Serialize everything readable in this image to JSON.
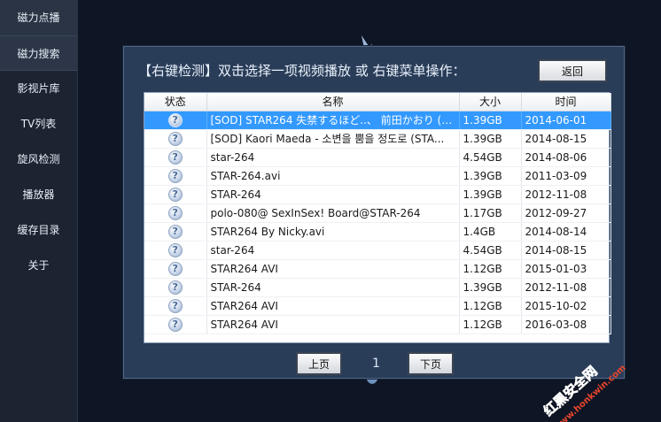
{
  "sidebar": {
    "items": [
      {
        "label": "磁力点播"
      },
      {
        "label": "磁力搜索"
      },
      {
        "label": "影视片库"
      },
      {
        "label": "TV列表"
      },
      {
        "label": "旋风检测"
      },
      {
        "label": "播放器"
      },
      {
        "label": "缓存目录"
      },
      {
        "label": "关于"
      }
    ]
  },
  "dialog": {
    "title": "【右键检测】双击选择一项视频播放 或 右键菜单操作：",
    "back_label": "返回",
    "columns": [
      "状态",
      "名称",
      "大小",
      "时间"
    ],
    "rows": [
      {
        "name": "[SOD] STAR264 失禁するほど..、 前田かおり (X...",
        "size": "1.39GB",
        "date": "2014-06-01"
      },
      {
        "name": "[SOD] Kaori Maeda - 소변을 뿜을 정도로 (STA...",
        "size": "1.39GB",
        "date": "2014-08-15"
      },
      {
        "name": "star-264",
        "size": "4.54GB",
        "date": "2014-08-06"
      },
      {
        "name": "STAR-264.avi",
        "size": "1.39GB",
        "date": "2011-03-09"
      },
      {
        "name": "STAR-264",
        "size": "1.39GB",
        "date": "2012-11-08"
      },
      {
        "name": "polo-080@ SexInSex! Board@STAR-264",
        "size": "1.17GB",
        "date": "2012-09-27"
      },
      {
        "name": "STAR264 By Nicky.avi",
        "size": "1.4GB",
        "date": "2014-08-14"
      },
      {
        "name": "star-264",
        "size": "4.54GB",
        "date": "2014-08-15"
      },
      {
        "name": "STAR264 AVI",
        "size": "1.12GB",
        "date": "2015-01-03"
      },
      {
        "name": "STAR-264",
        "size": "1.39GB",
        "date": "2012-11-08"
      },
      {
        "name": "STAR264 AVI",
        "size": "1.12GB",
        "date": "2015-10-02"
      },
      {
        "name": "STAR264 AVI",
        "size": "1.12GB",
        "date": "2016-03-08"
      }
    ],
    "status_icon": "question-icon",
    "status_glyph": "?",
    "prev_label": "上页",
    "next_label": "下页",
    "page": "1"
  },
  "watermark": {
    "line1": "红黑安全网",
    "line2": "www.honkwin.com"
  },
  "colors": {
    "selection": "#3399ff",
    "dialog_bg": "#2a3d58",
    "sidebar_bg": "#1d2431"
  }
}
